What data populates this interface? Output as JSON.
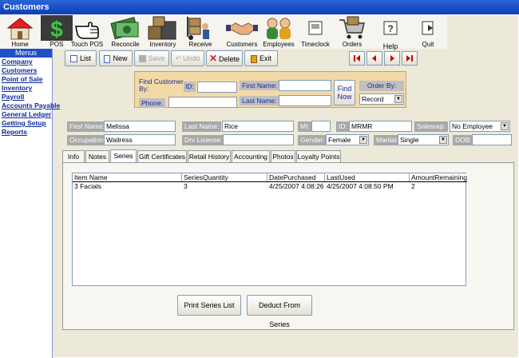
{
  "window": {
    "title": "Customers"
  },
  "toolbar": [
    {
      "label": "Home",
      "icon": "house-icon"
    },
    {
      "label": "POS",
      "icon": "dollar-sign-icon"
    },
    {
      "label": "Touch  POS",
      "icon": "pointing-hand-icon"
    },
    {
      "label": "Reconcile",
      "icon": "cash-icon"
    },
    {
      "label": "Inventory",
      "icon": "boxes-icon"
    },
    {
      "label": "Receive",
      "icon": "hand-truck-icon"
    },
    {
      "label": "Customers",
      "icon": "handshake-icon"
    },
    {
      "label": "Employees",
      "icon": "people-icon"
    },
    {
      "label": "Timeclock",
      "icon": "timeclock-icon"
    },
    {
      "label": "Orders",
      "icon": "cart-icon"
    },
    {
      "label": "Help",
      "icon": "help-icon"
    },
    {
      "label": "Quit",
      "icon": "exit-door-icon"
    }
  ],
  "sidebar": {
    "header": "Menus",
    "items": [
      "Company",
      "Customers",
      "Point of Sale",
      "Inventory",
      "Payroll",
      "Accounts Payable",
      "General Ledger",
      "Getting Setup",
      "Reports"
    ]
  },
  "actions": {
    "list": "List",
    "new": "New",
    "save": "Save",
    "undo": "Undo",
    "delete": "Delete",
    "exit": "Exit"
  },
  "find": {
    "label": "Find Customer By:",
    "id_label": "ID:",
    "id_value": "",
    "phone_label": "Phone:",
    "phone_value": "",
    "first_name_label": "First Name:",
    "first_name_value": "",
    "last_name_label": "Last Name:",
    "last_name_value": "",
    "find_now": "Find Now",
    "order_by_label": "Order By:",
    "order_by_value": "Record"
  },
  "customer": {
    "first_name_label": "First Name:",
    "first_name": "Melissa",
    "last_name_label": "Last Name:",
    "last_name": "Rice",
    "mi_label": "MI:",
    "mi": "",
    "id_label": "ID:",
    "id": "MRMR",
    "salesrep_label": "Salesrep:",
    "salesrep": "No Employee",
    "occupation_label": "Occupation:",
    "occupation": "Waitress",
    "drv_license_label": "Drv License:",
    "drv_license": "",
    "gender_label": "Gender:",
    "gender": "Female",
    "marital_label": "Marital:",
    "marital": "Single",
    "dob_label": "DOB:",
    "dob": ""
  },
  "tabs": [
    "Info",
    "Notes",
    "Series",
    "Gift Certificates",
    "Retail History",
    "Accounting",
    "Photos",
    "Loyalty Points"
  ],
  "active_tab": "Series",
  "series_table": {
    "columns": [
      "Item Name",
      "SeriesQuantity",
      "DatePurchased",
      "LastUsed",
      "AmountRemaining"
    ],
    "rows": [
      [
        "3 Facials",
        "3",
        "4/25/2007 4:08:26",
        "4/25/2007 4:08:50 PM",
        "2"
      ]
    ]
  },
  "series_buttons": {
    "print": "Print Series List",
    "deduct": "Deduct From Series"
  }
}
